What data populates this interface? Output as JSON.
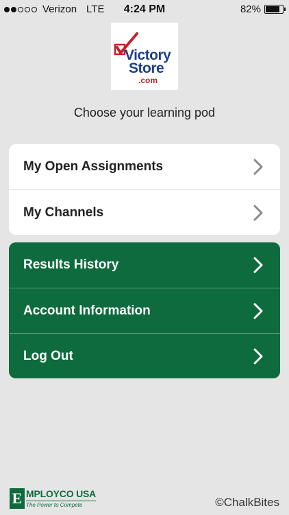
{
  "status_bar": {
    "carrier": "Verizon",
    "network": "LTE",
    "time": "4:24 PM",
    "battery_percent": "82%",
    "battery_level": 0.82,
    "signal_bars_filled": 2,
    "signal_bars_total": 5
  },
  "logo": {
    "line1": "Victory",
    "line2": "Store",
    "line3": ".com",
    "check_color": "#c71f2c",
    "text_color": "#1d3f8a"
  },
  "subtitle": "Choose your learning pod",
  "menu_white": {
    "items": [
      {
        "label": "My Open Assignments",
        "icon": "chevron-right-icon"
      },
      {
        "label": "My Channels",
        "icon": "chevron-right-icon"
      }
    ]
  },
  "menu_green": {
    "color": "#0e6b3d",
    "items": [
      {
        "label": "Results History",
        "icon": "chevron-right-icon"
      },
      {
        "label": "Account Information",
        "icon": "chevron-right-icon"
      },
      {
        "label": "Log Out",
        "icon": "chevron-right-icon"
      }
    ]
  },
  "footer": {
    "employco_letter": "E",
    "employco_name": "MPLOYCO USA",
    "employco_tagline": "The Power to Compete",
    "copyright": "©ChalkBites"
  }
}
